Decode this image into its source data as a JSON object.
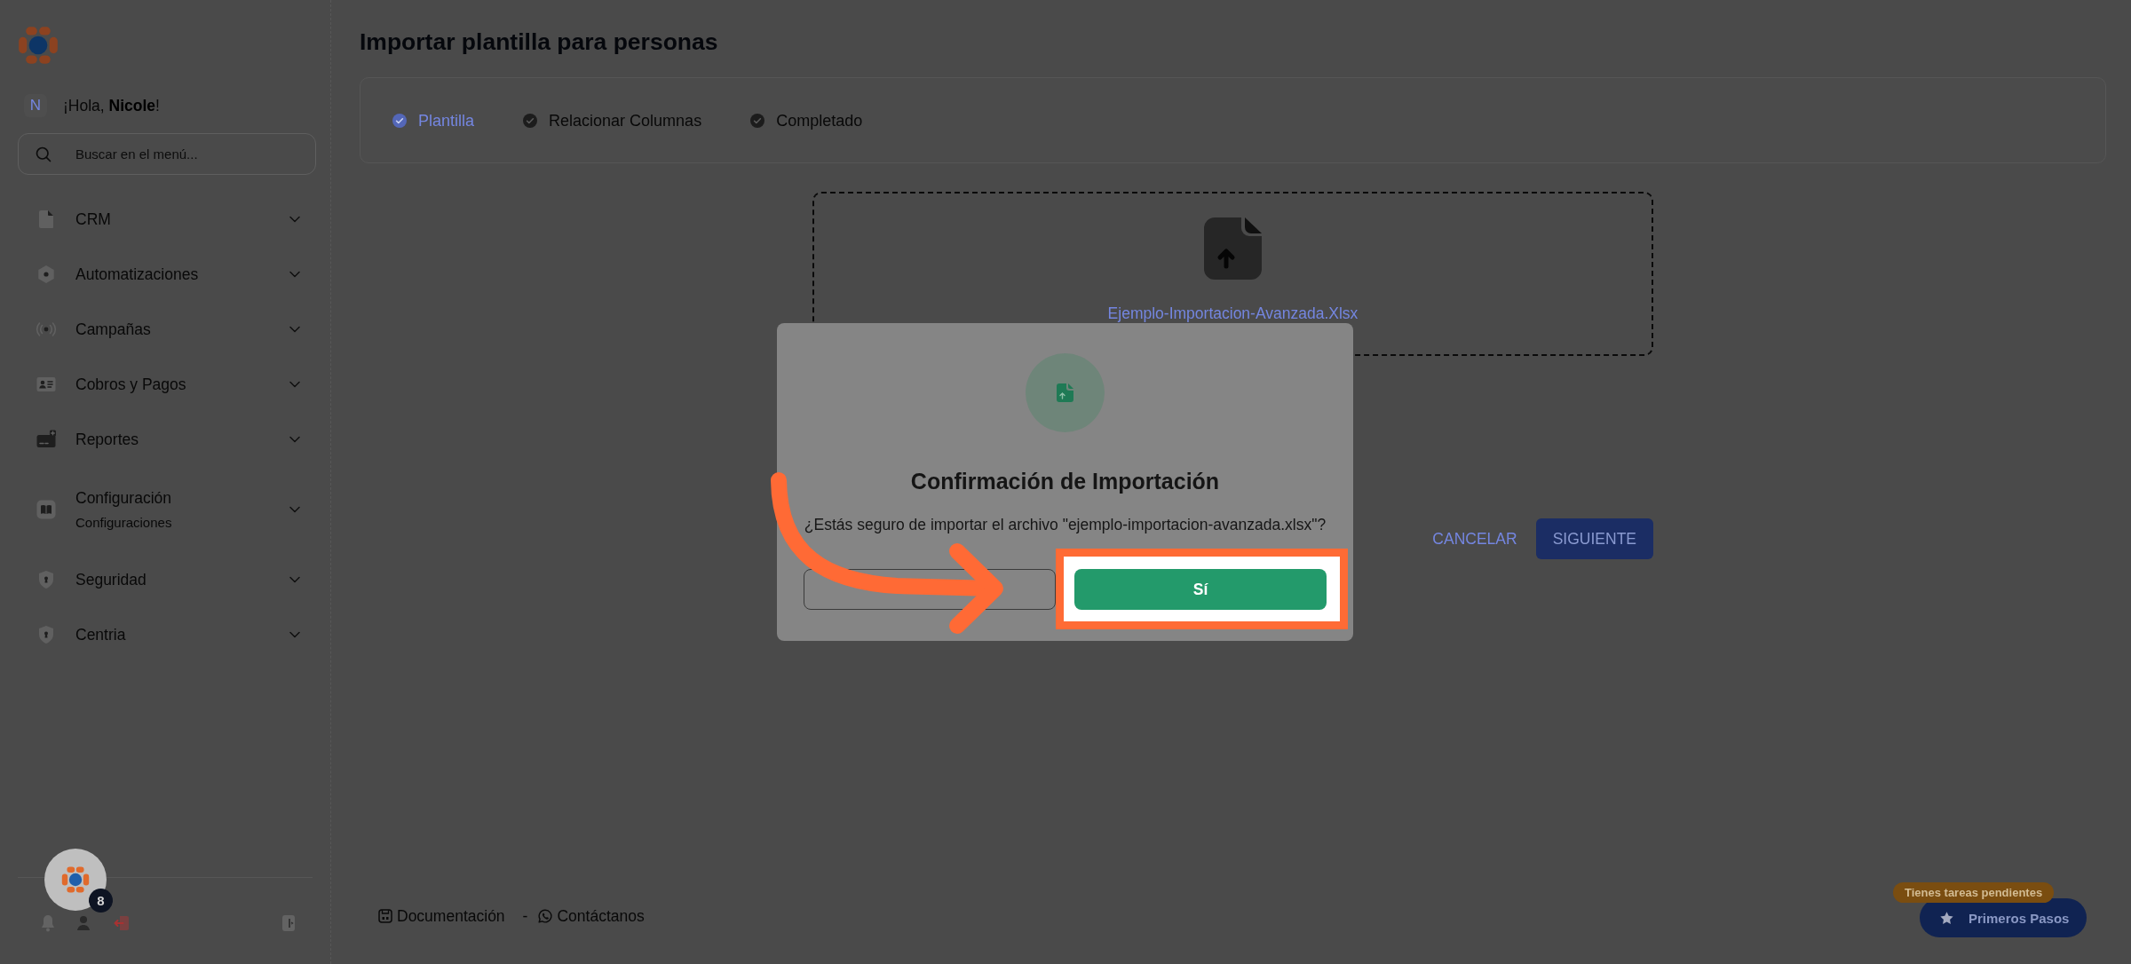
{
  "sidebar": {
    "user": {
      "initial": "N",
      "greeting": "¡Hola, **Nicole**!"
    },
    "search": {
      "placeholder": "Buscar en el menú..."
    },
    "menu": [
      {
        "label": "CRM",
        "expanded": false
      },
      {
        "label": "Automatizaciones",
        "expanded": false
      },
      {
        "label": "Campañas",
        "expanded": false
      },
      {
        "label": "Cobros y Pagos",
        "expanded": false
      },
      {
        "label": "Reportes",
        "expanded": false
      },
      {
        "label": "Configuración",
        "caption": "Configuraciones",
        "expanded": false
      },
      {
        "label": "Seguridad",
        "expanded": false
      },
      {
        "label": "Centria",
        "expanded": false
      }
    ],
    "assistant": {
      "badge": "8"
    }
  },
  "page": {
    "title": "Importar plantilla para personas"
  },
  "stepper": [
    {
      "label": "Plantilla",
      "selected": true
    },
    {
      "label": "Relacionar Columnas",
      "selected": false
    },
    {
      "label": "Completado",
      "selected": false
    }
  ],
  "upload": {
    "file_name": "Ejemplo-Importacion-Avanzada.Xlsx"
  },
  "actions": [
    {
      "label": "CANCELAR",
      "kind": "text"
    },
    {
      "label": "SIGUIENTE",
      "kind": "filled"
    }
  ],
  "footer": [
    {
      "kind": "link",
      "label": "Documentación"
    },
    {
      "kind": "separator",
      "label": "-"
    },
    {
      "kind": "link",
      "label": "Contáctanos"
    }
  ],
  "dialog": {
    "title": "Confirmación de Importación",
    "message": "¿Estás seguro de importar el archivo \"ejemplo-importacion-avanzada.xlsx\"?",
    "buttons": [
      {
        "kind": "outlined",
        "highlighted": false
      },
      {
        "kind": "filled",
        "label": "Sí",
        "highlighted": true
      }
    ]
  },
  "onboarding": {
    "badge": "Tienes tareas pendientes",
    "button": "Primeros Pasos"
  }
}
